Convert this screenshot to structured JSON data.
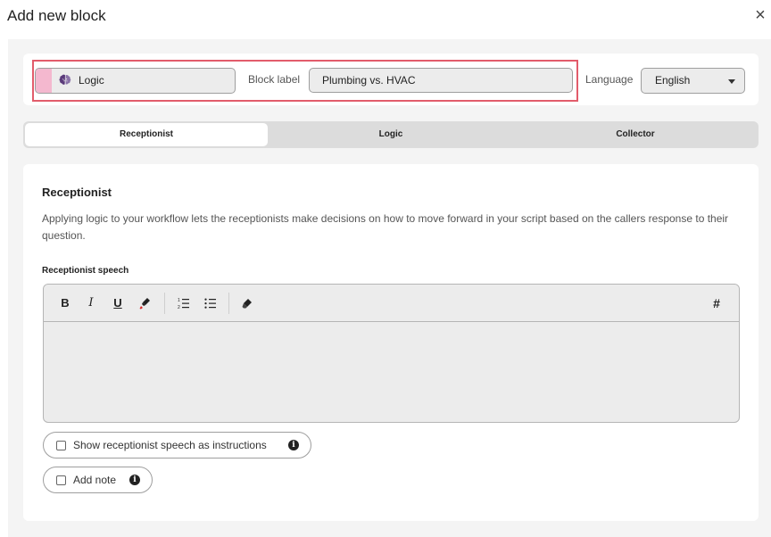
{
  "dialog": {
    "title": "Add new block",
    "close": "×"
  },
  "top_bar": {
    "type_label": "Logic",
    "type_color": "#f4b8cf",
    "type_icon": "brain-icon",
    "block_label_text": "Block label",
    "block_label_value": "Plumbing vs. HVAC",
    "language_text": "Language",
    "language_value": "English"
  },
  "tabs": [
    {
      "label": "Receptionist",
      "active": true
    },
    {
      "label": "Logic",
      "active": false
    },
    {
      "label": "Collector",
      "active": false
    }
  ],
  "section": {
    "title": "Receptionist",
    "description": "Applying logic to your workflow lets the receptionists make decisions on how to move forward in your script based on the callers response to their question.",
    "speech_label": "Receptionist speech"
  },
  "toolbar": {
    "bold": "B",
    "italic": "I",
    "underline": "U",
    "hash": "#",
    "icons": [
      "bold-icon",
      "italic-icon",
      "underline-icon",
      "highlight-icon",
      "ordered-list-icon",
      "bullet-list-icon",
      "eraser-icon",
      "hash-icon"
    ]
  },
  "options": {
    "show_instructions": "Show receptionist speech as instructions",
    "add_note": "Add note",
    "info": "i"
  },
  "colors": {
    "highlight_border": "#e25c6b",
    "panel_bg": "#f4f4f4"
  }
}
